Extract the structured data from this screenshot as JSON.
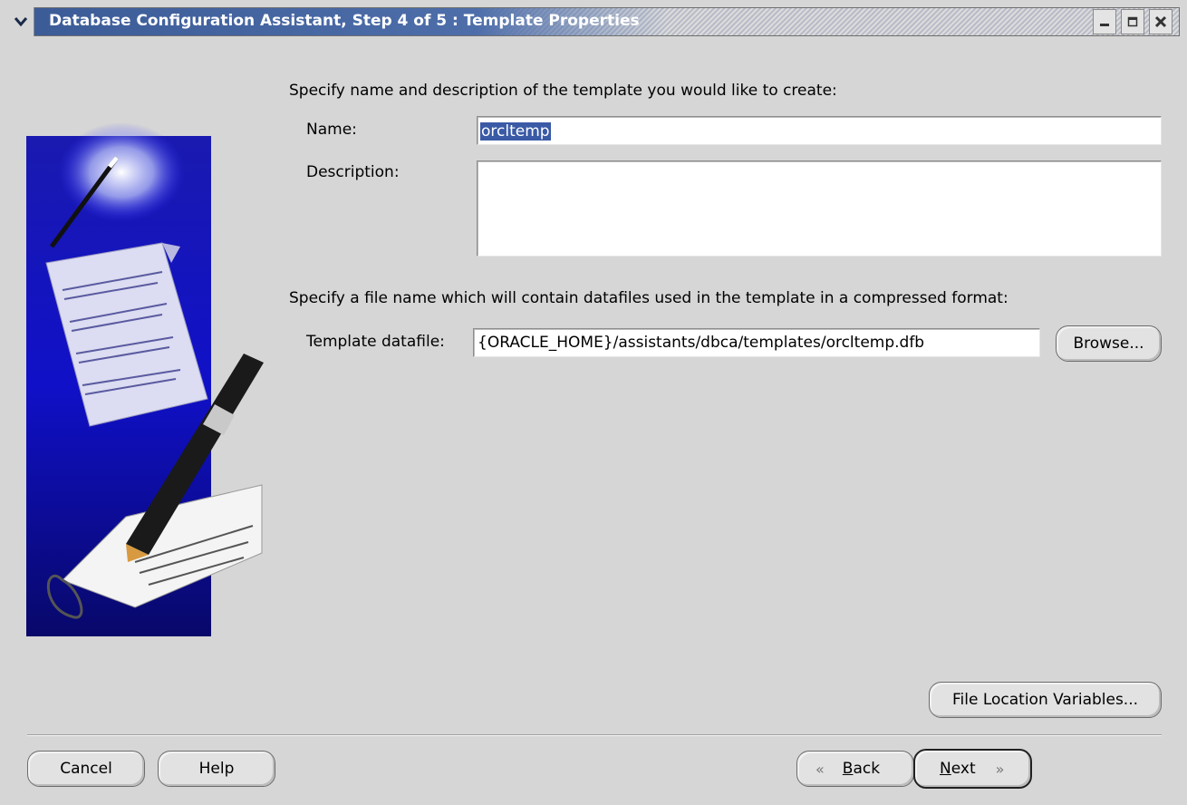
{
  "window": {
    "title": "Database Configuration Assistant, Step 4 of 5 : Template Properties"
  },
  "form": {
    "intro": "Specify name and description of the template you would like to create:",
    "name_label": "Name:",
    "name_value": "orcltemp",
    "description_label": "Description:",
    "description_value": "",
    "datafile_intro": "Specify a file name which will contain datafiles used in the template in a compressed format:",
    "datafile_label": "Template datafile:",
    "datafile_value": "{ORACLE_HOME}/assistants/dbca/templates/orcltemp.dfb",
    "browse_label": "Browse...",
    "file_location_label": "File Location Variables..."
  },
  "footer": {
    "cancel_label": "Cancel",
    "help_label": "Help",
    "back_mnemonic": "B",
    "back_rest": "ack",
    "next_mnemonic": "N",
    "next_rest": "ext"
  }
}
